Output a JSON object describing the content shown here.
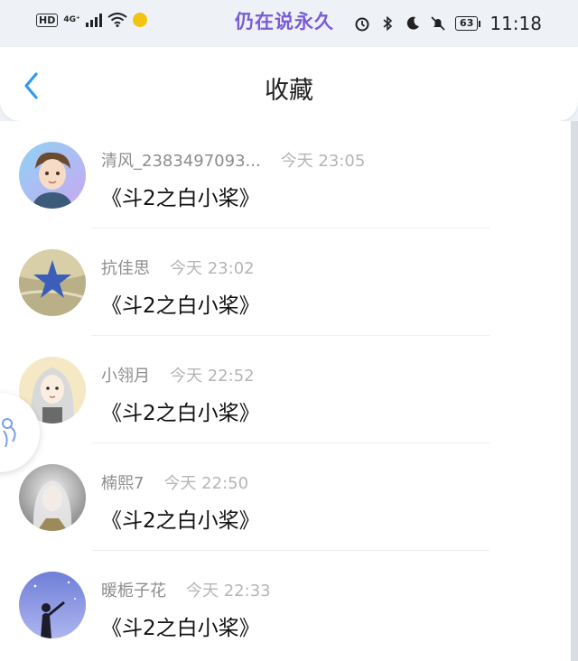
{
  "status_bar": {
    "hd_label": "HD",
    "network_label": "4G⁺",
    "overlay_text": "仍在说永久",
    "battery": "63",
    "time": "11:18"
  },
  "header": {
    "title": "收藏",
    "back_icon": "chevron-left-icon",
    "accent_color": "#2f9bea"
  },
  "favorites": [
    {
      "user": "清风_2383497093...",
      "time": "今天 23:05",
      "content": "《斗2之白小桨》"
    },
    {
      "user": "抗佳思",
      "time": "今天 23:02",
      "content": "《斗2之白小桨》"
    },
    {
      "user": "小翎月",
      "time": "今天 22:52",
      "content": "《斗2之白小桨》"
    },
    {
      "user": "楠熙7",
      "time": "今天 22:50",
      "content": "《斗2之白小桨》"
    },
    {
      "user": "暖栀子花",
      "time": "今天 22:33",
      "content": "《斗2之白小桨》"
    }
  ]
}
